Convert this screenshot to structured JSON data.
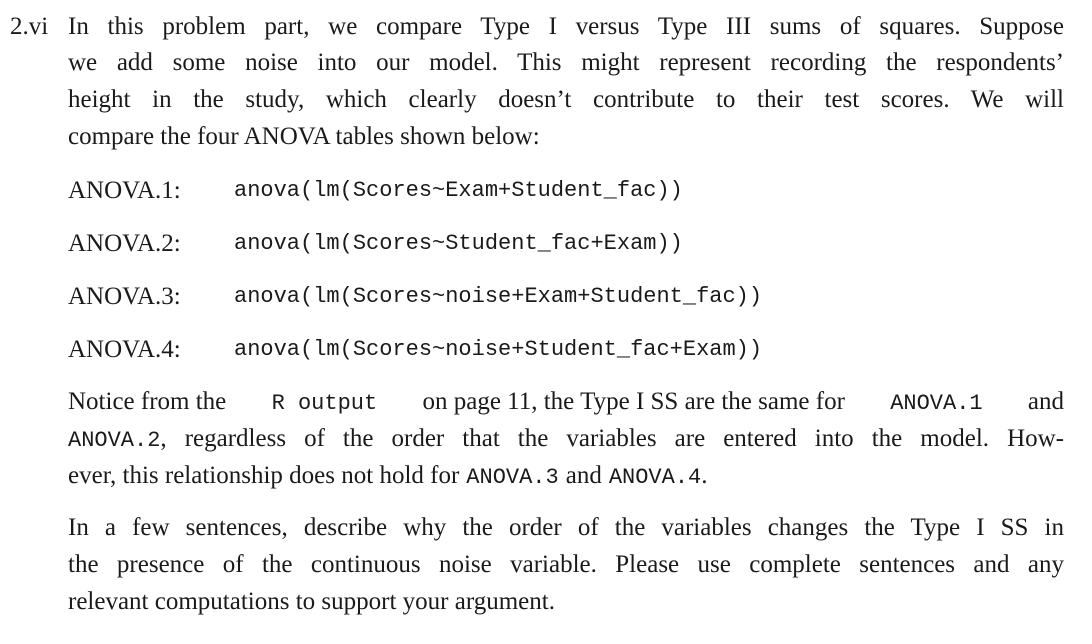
{
  "problem": {
    "number": "2.vi",
    "intro_lines": [
      "In this problem part, we compare Type I versus Type III sums of squares. Suppose",
      "we add some noise into our model. This might represent recording the respondents’",
      "height in the study, which clearly doesn’t contribute to their test scores. We will",
      "compare the four ANOVA tables shown below:"
    ],
    "anova": [
      {
        "label": "ANOVA.1:",
        "code": "anova(lm(Scores~Exam+Student_fac))"
      },
      {
        "label": "ANOVA.2:",
        "code": "anova(lm(Scores~Student_fac+Exam))"
      },
      {
        "label": "ANOVA.3:",
        "code": "anova(lm(Scores~noise+Exam+Student_fac))"
      },
      {
        "label": "ANOVA.4:",
        "code": "anova(lm(Scores~noise+Student_fac+Exam))"
      }
    ],
    "notice": {
      "line1_a": "Notice from the",
      "line1_code1": "R output",
      "line1_b": "on page 11, the Type I SS are the same for",
      "line1_code2": "ANOVA.1",
      "line1_c": "and",
      "line2_code": "ANOVA.2",
      "line2_text": ", regardless of the order that the variables are entered into the model. How-",
      "line3_a": "ever, this relationship does not hold for",
      "line3_code1": "ANOVA.3",
      "line3_b": "and",
      "line3_code2": "ANOVA.4",
      "line3_c": "."
    },
    "question_lines": [
      "In a few sentences, describe why the order of the variables changes the Type I SS in",
      "the presence of the continuous noise variable. Please use complete sentences and any",
      "relevant computations to support your argument."
    ]
  }
}
